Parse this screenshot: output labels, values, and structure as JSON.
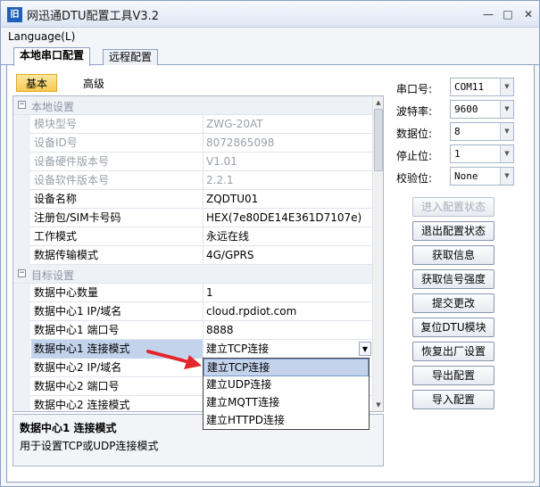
{
  "window": {
    "title": "网迅通DTU配置工具V3.2",
    "app_icon_text": "旧"
  },
  "menu": {
    "language": "Language(L)"
  },
  "tabs": [
    {
      "label": "本地串口配置"
    },
    {
      "label": "远程配置"
    }
  ],
  "subtabs": [
    {
      "label": "基本"
    },
    {
      "label": "高级"
    }
  ],
  "grid": {
    "cat1": "本地设置",
    "rows1": [
      {
        "name": "模块型号",
        "value": "ZWG-20AT"
      },
      {
        "name": "设备ID号",
        "value": "8072865098"
      },
      {
        "name": "设备硬件版本号",
        "value": "V1.01"
      },
      {
        "name": "设备软件版本号",
        "value": "2.2.1"
      },
      {
        "name": "设备名称",
        "value": "ZQDTU01"
      },
      {
        "name": "注册包/SIM卡号码",
        "value": "HEX(7e80DE14E361D7107e)"
      },
      {
        "name": "工作模式",
        "value": "永远在线"
      },
      {
        "name": "数据传输模式",
        "value": "4G/GPRS"
      }
    ],
    "cat2": "目标设置",
    "rows2": [
      {
        "name": "数据中心数量",
        "value": "1"
      },
      {
        "name": "数据中心1 IP/域名",
        "value": "cloud.rpdiot.com"
      },
      {
        "name": "数据中心1 端口号",
        "value": "8888"
      },
      {
        "name": "数据中心1 连接模式",
        "value": "建立TCP连接"
      },
      {
        "name": "数据中心2 IP/域名",
        "value": ""
      },
      {
        "name": "数据中心2 端口号",
        "value": ""
      },
      {
        "name": "数据中心2 连接模式",
        "value": ""
      }
    ]
  },
  "dropdown": {
    "options": [
      "建立TCP连接",
      "建立UDP连接",
      "建立MQTT连接",
      "建立HTTPD连接"
    ]
  },
  "description": {
    "title": "数据中心1 连接模式",
    "text": "用于设置TCP或UDP连接模式"
  },
  "serial": {
    "port_label": "串口号:",
    "port_value": "COM11",
    "baud_label": "波特率:",
    "baud_value": "9600",
    "data_label": "数据位:",
    "data_value": "8",
    "stop_label": "停止位:",
    "stop_value": "1",
    "parity_label": "校验位:",
    "parity_value": "None"
  },
  "buttons": {
    "enter_config": "进入配置状态",
    "exit_config": "退出配置状态",
    "get_info": "获取信息",
    "get_signal": "获取信号强度",
    "submit": "提交更改",
    "reset": "复位DTU模块",
    "factory": "恢复出厂设置",
    "export": "导出配置",
    "import": "导入配置"
  }
}
